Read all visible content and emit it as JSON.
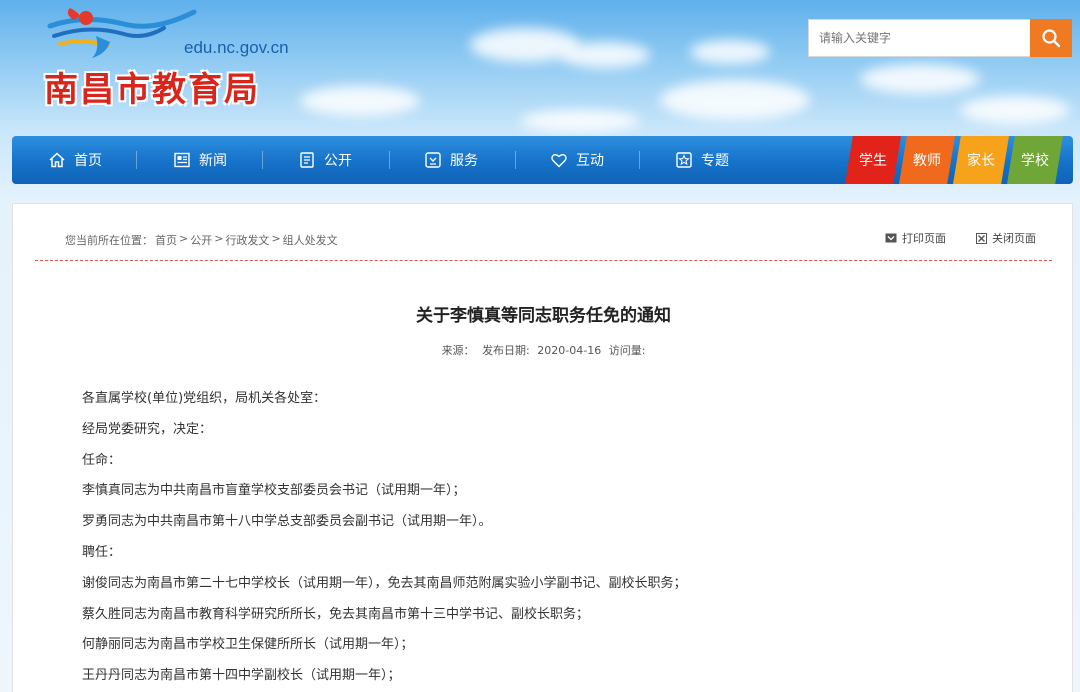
{
  "header": {
    "site_domain": "edu.nc.gov.cn",
    "site_name": "南昌市教育局"
  },
  "search": {
    "placeholder": "请输入关键字",
    "button_icon": "search-icon"
  },
  "nav": {
    "items": [
      {
        "label": "首页",
        "icon": "home-icon"
      },
      {
        "label": "新闻",
        "icon": "news-icon"
      },
      {
        "label": "公开",
        "icon": "document-icon"
      },
      {
        "label": "服务",
        "icon": "service-icon"
      },
      {
        "label": "互动",
        "icon": "heart-icon"
      },
      {
        "label": "专题",
        "icon": "star-icon"
      }
    ],
    "roles": [
      {
        "label": "学生",
        "color": "#e2231a"
      },
      {
        "label": "教师",
        "color": "#f06a1d"
      },
      {
        "label": "家长",
        "color": "#f7a21b"
      },
      {
        "label": "学校",
        "color": "#6fa637"
      }
    ]
  },
  "breadcrumb": {
    "prefix": "您当前所在位置：",
    "items": [
      "首页",
      "公开",
      "行政发文",
      "组人处发文"
    ],
    "separator": ">"
  },
  "tools": {
    "print": "打印页面",
    "close": "关闭页面"
  },
  "article": {
    "title": "关于李慎真等同志职务任免的通知",
    "source_label": "来源：",
    "date_label": "发布日期:",
    "date": "2020-04-16",
    "views_label": "访问量:",
    "paragraphs": [
      "各直属学校(单位)党组织，局机关各处室：",
      "经局党委研究，决定：",
      "任命：",
      "李慎真同志为中共南昌市盲童学校支部委员会书记（试用期一年）；",
      "罗勇同志为中共南昌市第十八中学总支部委员会副书记（试用期一年）。",
      "聘任：",
      "谢俊同志为南昌市第二十七中学校长（试用期一年），免去其南昌师范附属实验小学副书记、副校长职务；",
      "蔡久胜同志为南昌市教育科学研究所所长，免去其南昌市第十三中学书记、副校长职务；",
      "何静丽同志为南昌市学校卫生保健所所长（试用期一年）；",
      "王丹丹同志为南昌市第十四中学副校长（试用期一年）；"
    ]
  }
}
